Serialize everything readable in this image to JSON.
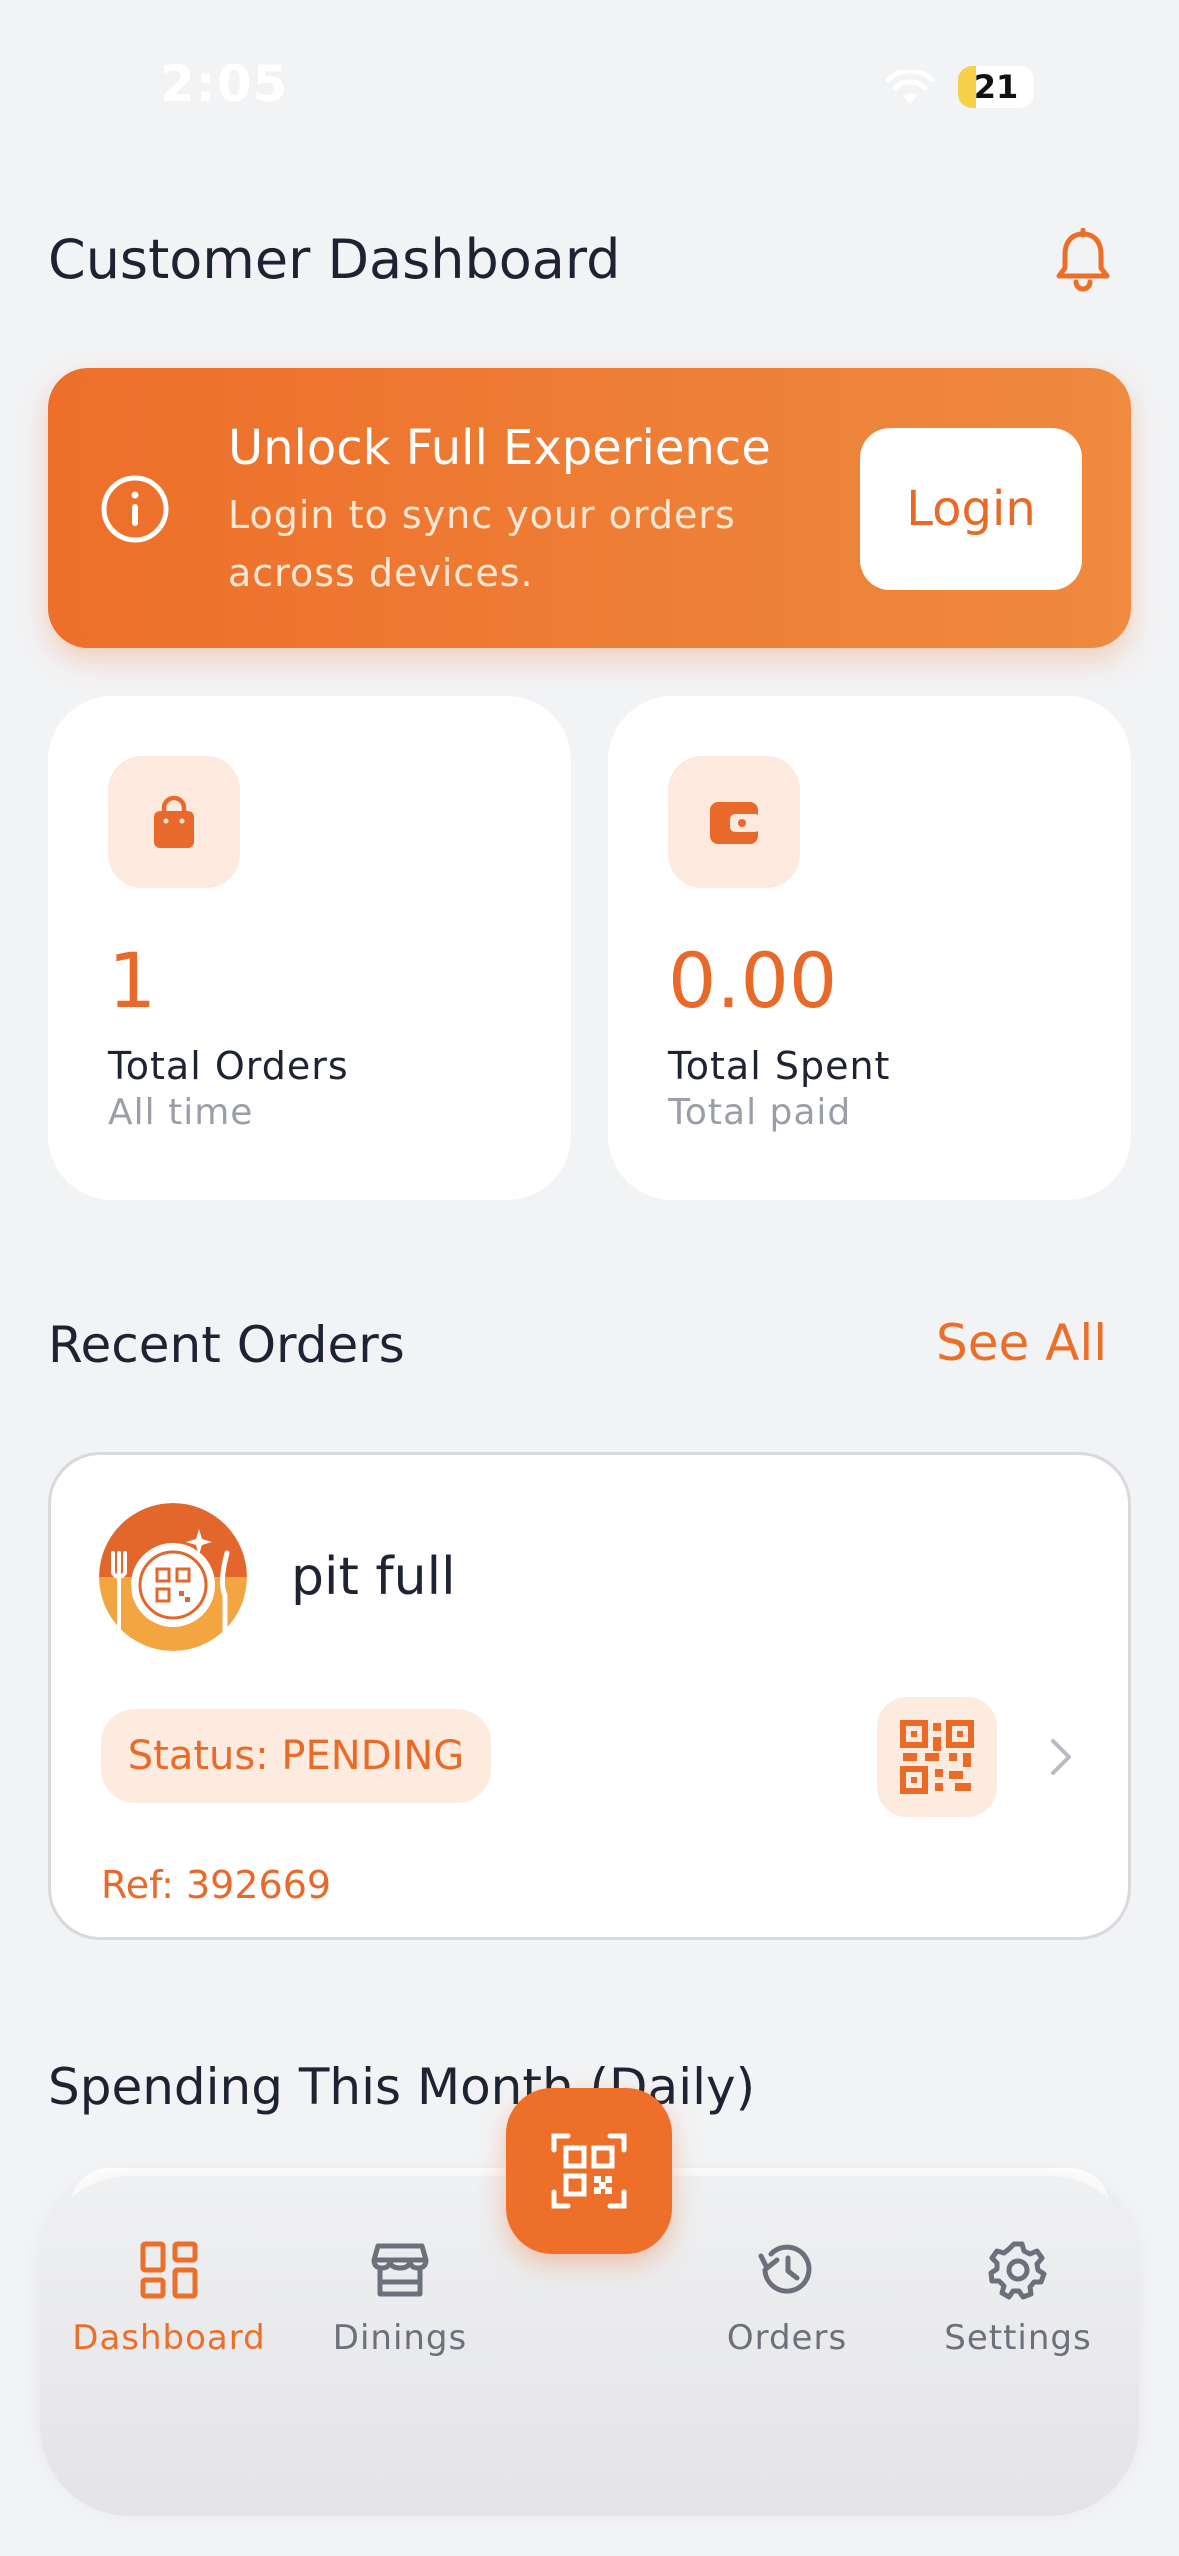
{
  "status_bar": {
    "time": "2:05",
    "battery": "21"
  },
  "header": {
    "title": "Customer Dashboard",
    "icon": "bell-icon"
  },
  "banner": {
    "title": "Unlock Full Experience",
    "subtitle": "Login to sync your orders across devices.",
    "button_label": "Login",
    "icon": "info-icon"
  },
  "stats": [
    {
      "value": "1",
      "label": "Total Orders",
      "sub": "All time",
      "icon": "shopping-bag-icon"
    },
    {
      "value": "0.00",
      "label": "Total Spent",
      "sub": "Total paid",
      "icon": "wallet-icon"
    }
  ],
  "recent_orders": {
    "title": "Recent Orders",
    "see_all_label": "See All",
    "items": [
      {
        "name": "pit full",
        "status": "Status: PENDING",
        "ref": "Ref: 392669"
      }
    ]
  },
  "spending": {
    "title": "Spending This Month (Daily)"
  },
  "tabbar": {
    "items": [
      {
        "label": "Dashboard",
        "icon": "dashboard-icon",
        "active": true
      },
      {
        "label": "Dinings",
        "icon": "store-icon",
        "active": false
      },
      {
        "label": "Orders",
        "icon": "history-icon",
        "active": false
      },
      {
        "label": "Settings",
        "icon": "gear-icon",
        "active": false
      }
    ],
    "center_action_icon": "qr-scan-icon"
  },
  "colors": {
    "accent": "#ED6F2A",
    "background": "#F2F3F5",
    "soft_accent": "#FDEBE0"
  }
}
